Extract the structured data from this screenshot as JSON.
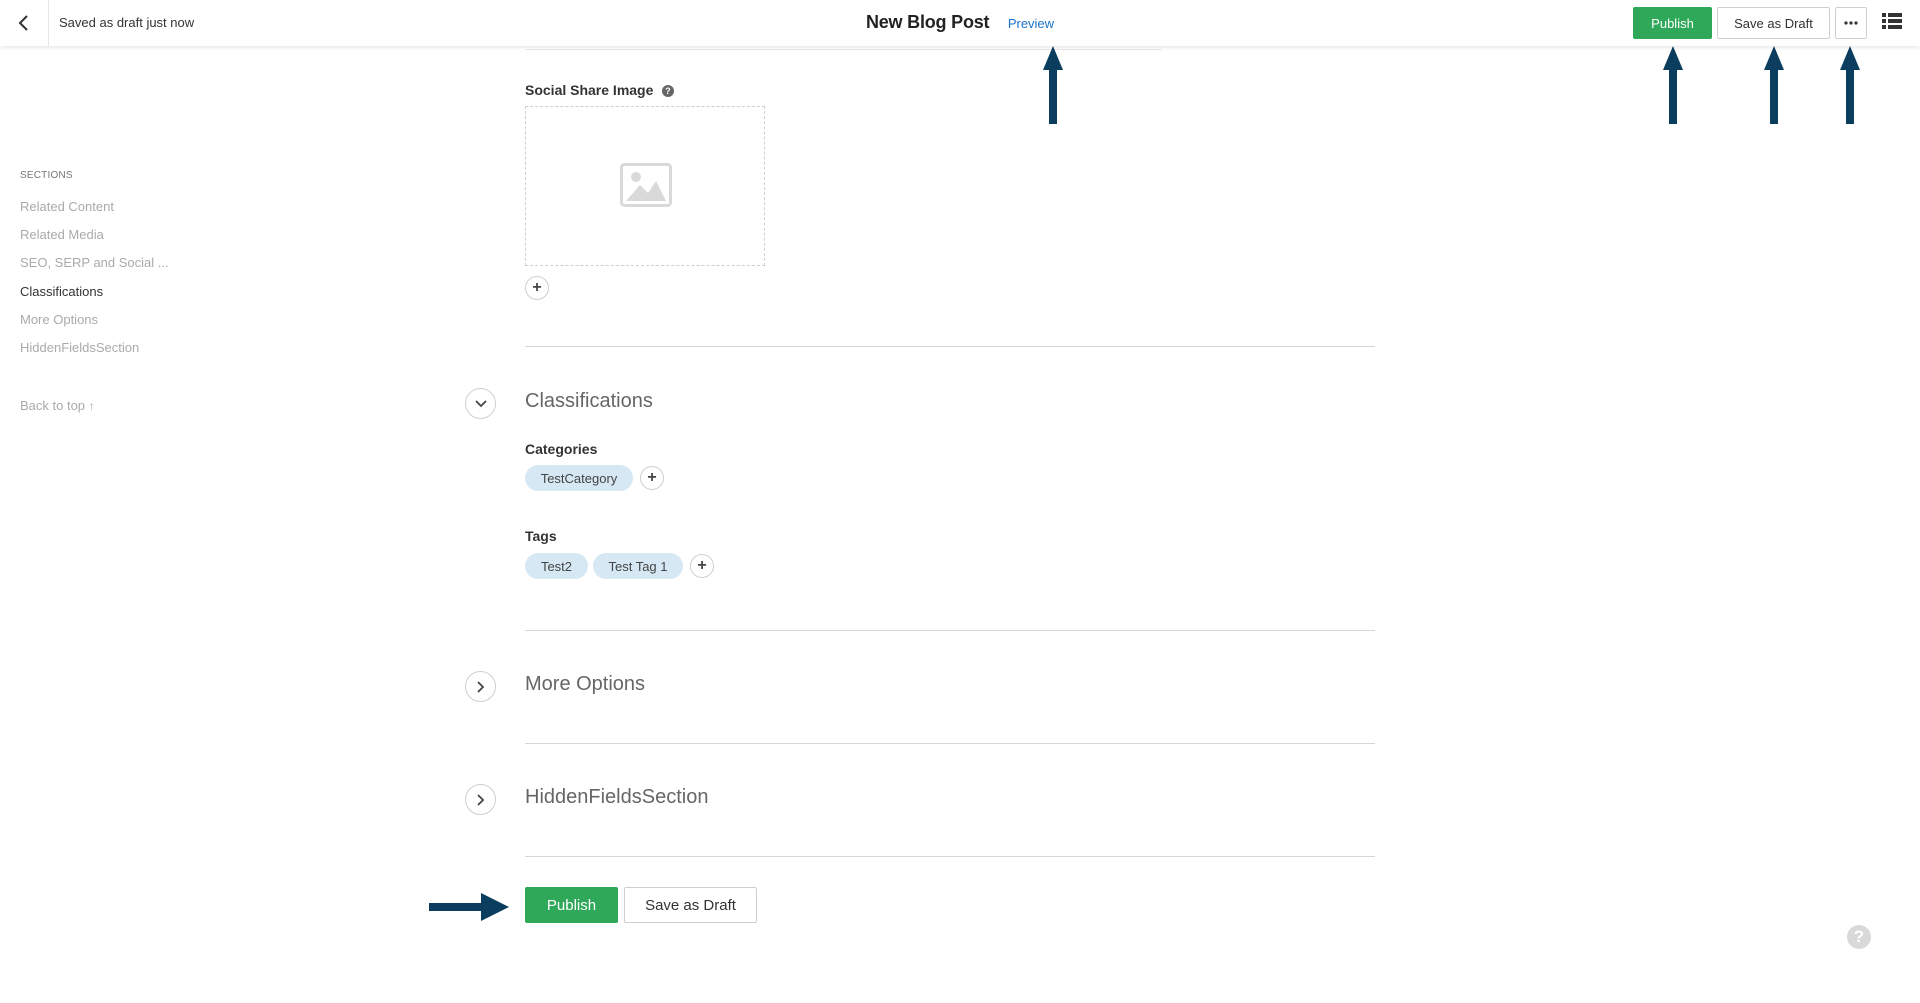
{
  "header": {
    "status": "Saved as draft just now",
    "title": "New Blog Post",
    "preview_label": "Preview",
    "publish_label": "Publish",
    "save_draft_label": "Save as Draft",
    "icons": [
      "chevron-left-icon",
      "more-dots-icon",
      "list-view-icon"
    ]
  },
  "sidebar": {
    "heading": "SECTIONS",
    "items": [
      {
        "label": "Related Content"
      },
      {
        "label": "Related Media"
      },
      {
        "label": "SEO, SERP and Social ..."
      },
      {
        "label": "Classifications",
        "active": true
      },
      {
        "label": "More Options"
      },
      {
        "label": "HiddenFieldsSection"
      }
    ],
    "back_to_top": "Back to top"
  },
  "main": {
    "social_share_label": "Social Share Image",
    "classifications_title": "Classifications",
    "categories_label": "Categories",
    "categories": [
      "TestCategory"
    ],
    "tags_label": "Tags",
    "tags": [
      "Test2",
      "Test Tag 1"
    ],
    "more_options_title": "More Options",
    "hidden_fields_title": "HiddenFieldsSection"
  },
  "footer": {
    "publish_label": "Publish",
    "save_draft_label": "Save as Draft"
  },
  "colors": {
    "publish_green": "#2fa859",
    "chip_blue": "#d6e8f4",
    "annotation_arrow": "#0b3d5e",
    "link_blue": "#1a73c9"
  }
}
